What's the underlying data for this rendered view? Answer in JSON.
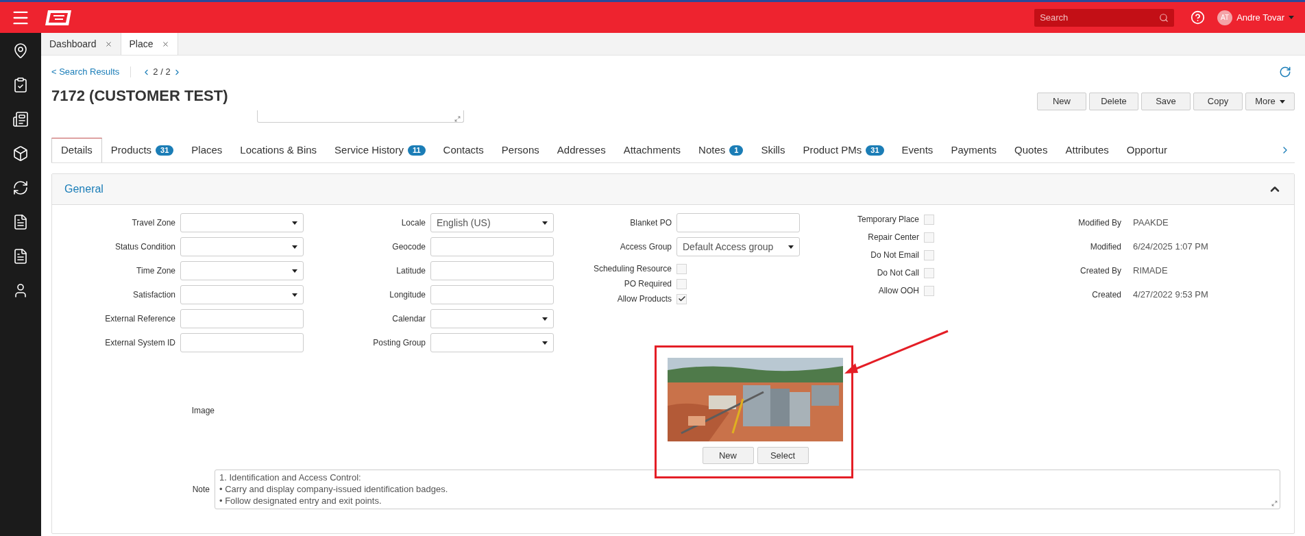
{
  "header": {
    "search_placeholder": "Search",
    "user_initials": "AT",
    "user_name": "Andre Tovar"
  },
  "open_tabs": [
    {
      "label": "Dashboard",
      "selected": false
    },
    {
      "label": "Place",
      "selected": true
    }
  ],
  "breadcrumb": {
    "back": "< Search Results",
    "pager": "2 / 2"
  },
  "title": "7172 (CUSTOMER TEST)",
  "actions": [
    "New",
    "Delete",
    "Save",
    "Copy",
    "More"
  ],
  "tabs": [
    {
      "label": "Details",
      "selected": true
    },
    {
      "label": "Products",
      "badge": "31",
      "selected": false
    },
    {
      "label": "Places",
      "selected": false
    },
    {
      "label": "Locations & Bins",
      "selected": false
    },
    {
      "label": "Service History",
      "badge": "11",
      "selected": false
    },
    {
      "label": "Contacts",
      "selected": false
    },
    {
      "label": "Persons",
      "selected": false
    },
    {
      "label": "Addresses",
      "selected": false
    },
    {
      "label": "Attachments",
      "selected": false
    },
    {
      "label": "Notes",
      "badge": "1",
      "selected": false
    },
    {
      "label": "Skills",
      "selected": false
    },
    {
      "label": "Product PMs",
      "badge": "31",
      "selected": false
    },
    {
      "label": "Events",
      "selected": false
    },
    {
      "label": "Payments",
      "selected": false
    },
    {
      "label": "Quotes",
      "selected": false
    },
    {
      "label": "Attributes",
      "selected": false
    },
    {
      "label": "Opportur",
      "selected": false
    }
  ],
  "section": {
    "title": "General",
    "expanded": true
  },
  "column_1": [
    {
      "label": "Travel Zone",
      "kind": "select"
    },
    {
      "label": "Status Condition",
      "kind": "select"
    },
    {
      "label": "Time Zone",
      "kind": "select"
    },
    {
      "label": "Satisfaction",
      "kind": "select"
    },
    {
      "label": "External Reference",
      "kind": "input"
    },
    {
      "label": "External System ID",
      "kind": "input"
    }
  ],
  "column_2": [
    {
      "label": "Locale",
      "kind": "select",
      "value": "English (US)"
    },
    {
      "label": "Geocode",
      "kind": "input"
    },
    {
      "label": "Latitude",
      "kind": "input"
    },
    {
      "label": "Longitude",
      "kind": "input"
    },
    {
      "label": "Calendar",
      "kind": "select"
    },
    {
      "label": "Posting Group",
      "kind": "select"
    }
  ],
  "column_3": [
    {
      "label": "Blanket PO",
      "kind": "input"
    },
    {
      "label": "Access Group",
      "kind": "select",
      "value": "Default Access group"
    },
    {
      "label": "Scheduling Resource",
      "kind": "checkbox",
      "checked": false
    },
    {
      "label": "PO Required",
      "kind": "checkbox",
      "checked": false
    },
    {
      "label": "Allow Products",
      "kind": "checkbox",
      "checked": true
    }
  ],
  "column_4": [
    {
      "label": "Temporary Place",
      "checked": false
    },
    {
      "label": "Repair Center",
      "checked": false
    },
    {
      "label": "Do Not Email",
      "checked": false
    },
    {
      "label": "Do Not Call",
      "checked": false
    },
    {
      "label": "Allow OOH",
      "checked": false
    }
  ],
  "audit": [
    {
      "label": "Modified By",
      "value": "PAAKDE"
    },
    {
      "label": "Modified",
      "value": "6/24/2025 1:07 PM"
    },
    {
      "label": "Created By",
      "value": "RIMADE"
    },
    {
      "label": "Created",
      "value": "4/27/2022 9:53 PM"
    }
  ],
  "image": {
    "label": "Image",
    "kind": "picture",
    "buttons": [
      "New",
      "Select"
    ]
  },
  "note": {
    "label": "Note",
    "lines": [
      "1. Identification and Access Control:",
      "• Carry and display company-issued identification badges.",
      "• Follow designated entry and exit points."
    ]
  }
}
